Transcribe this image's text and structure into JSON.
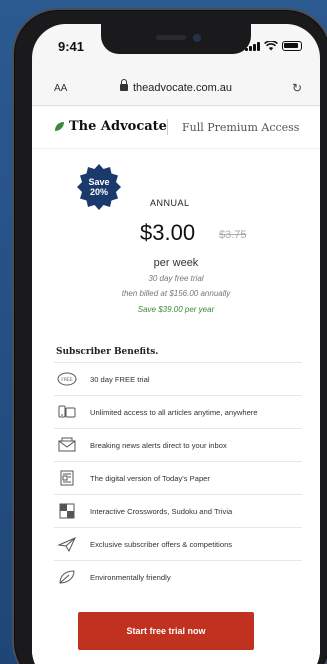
{
  "status": {
    "time": "9:41"
  },
  "browser": {
    "text_size": "AA",
    "url": "theadvocate.com.au"
  },
  "brand": {
    "logo": "The Advocate",
    "tagline": "Full Premium Access"
  },
  "offer": {
    "badge_line1": "Save",
    "badge_line2": "20%",
    "plan": "ANNUAL",
    "price": "$3.00",
    "old_price": "$3.75",
    "period": "per week",
    "trial": "30 day free trial",
    "billed": "then billed at $156.00 annually",
    "saving": "Save $39.00 per year"
  },
  "benefits": {
    "title": "Subscriber Benefits.",
    "items": [
      {
        "label": "30 day FREE trial",
        "icon": "free-icon"
      },
      {
        "label": "Unlimited access to all articles anytime, anywhere",
        "icon": "devices-icon"
      },
      {
        "label": "Breaking news alerts direct to your inbox",
        "icon": "mail-icon"
      },
      {
        "label": "The digital version of Today's Paper",
        "icon": "newspaper-icon"
      },
      {
        "label": "Interactive Crosswords, Sudoku and Trivia",
        "icon": "crossword-icon"
      },
      {
        "label": "Exclusive subscriber offers & competitions",
        "icon": "paper-plane-icon"
      },
      {
        "label": "Environmentally friendly",
        "icon": "leaf-icon"
      }
    ]
  },
  "cta": {
    "label": "Start free trial now"
  },
  "colors": {
    "accent": "#c0321f",
    "badge": "#1b3a6b",
    "saving": "#3a8a3a",
    "background": "#2b5a91"
  }
}
